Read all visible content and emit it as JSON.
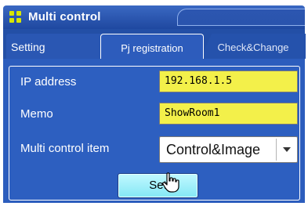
{
  "window": {
    "title": "Multi control"
  },
  "tabs": [
    {
      "label": "Setting"
    },
    {
      "label": "Pj registration"
    },
    {
      "label": "Check&Change"
    }
  ],
  "form": {
    "ip_label": "IP address",
    "ip_value": "192.168.1.5",
    "memo_label": "Memo",
    "memo_value": "ShowRoom1",
    "item_label": "Multi control item",
    "item_value": "Control&Image"
  },
  "buttons": {
    "set_label": "Set"
  },
  "icons": {
    "title": "grid-dots-icon",
    "dropdown": "chevron-down-icon",
    "cursor": "hand-pointer-icon"
  },
  "colors": {
    "title_bar": "#1f48a0",
    "panel": "#2c5dbd",
    "field": "#f3f04a",
    "button": "#a5f0fa"
  }
}
